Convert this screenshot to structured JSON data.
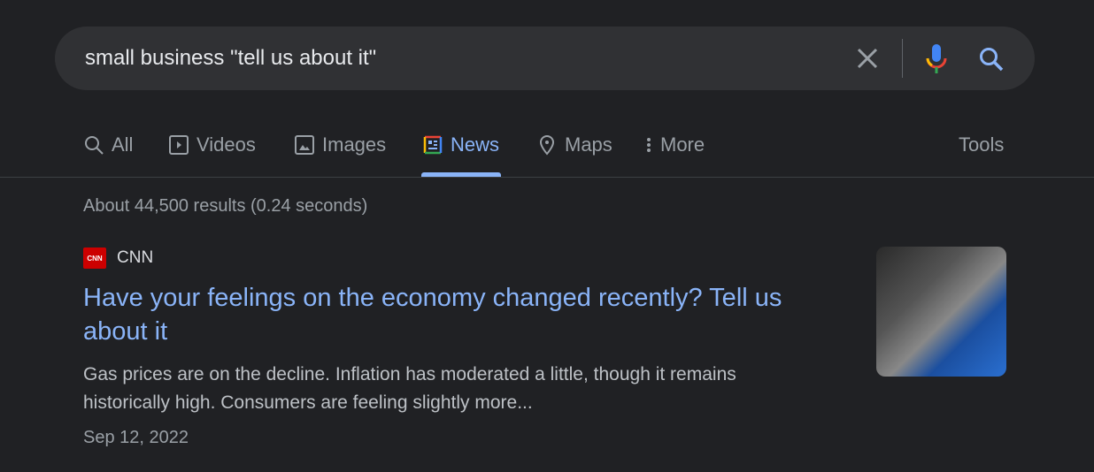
{
  "search": {
    "query": "small business \"tell us about it\""
  },
  "tabs": [
    {
      "label": "All",
      "icon": "search-icon"
    },
    {
      "label": "Videos",
      "icon": "play-icon"
    },
    {
      "label": "Images",
      "icon": "image-icon"
    },
    {
      "label": "News",
      "icon": "news-icon",
      "active": true
    },
    {
      "label": "Maps",
      "icon": "map-pin-icon"
    },
    {
      "label": "More",
      "icon": "dots-vertical-icon"
    }
  ],
  "tools_label": "Tools",
  "stats": "About 44,500 results (0.24 seconds)",
  "result": {
    "source": "CNN",
    "logo_text": "CNN",
    "title": "Have your feelings on the economy changed recently? Tell us about it",
    "snippet": "Gas prices are on the decline. Inflation has moderated a little, though it remains historically high. Consumers are feeling slightly more...",
    "date": "Sep 12, 2022"
  },
  "colors": {
    "accent": "#8ab4f8",
    "background": "#202124"
  }
}
